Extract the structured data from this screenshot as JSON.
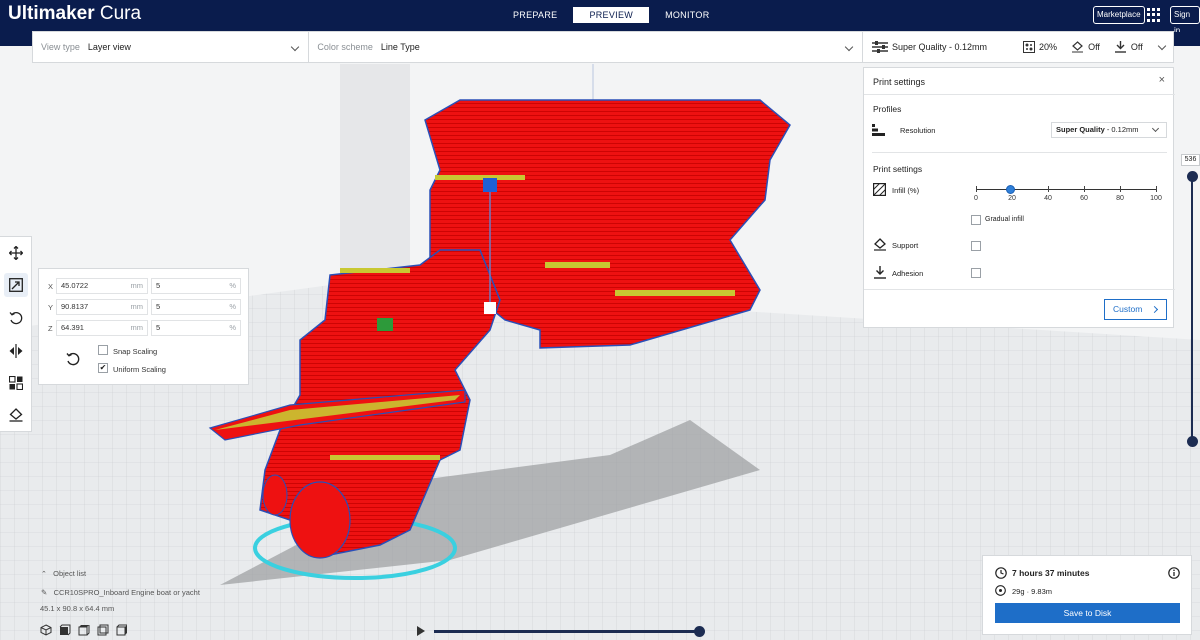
{
  "app": {
    "name_bold": "Ultimaker",
    "name_light": " Cura"
  },
  "stages": [
    "PREPARE",
    "PREVIEW",
    "MONITOR"
  ],
  "header": {
    "marketplace": "Marketplace",
    "signin": "Sign in"
  },
  "viewbar": {
    "view_type_label": "View type",
    "view_type_value": "Layer view",
    "color_scheme_label": "Color scheme",
    "color_scheme_value": "Line Type"
  },
  "quality_bar": {
    "profile": "Super Quality - 0.12mm",
    "infill": "20%",
    "support": "Off",
    "adhesion": "Off"
  },
  "print_settings": {
    "title": "Print settings",
    "close": "×",
    "profiles_heading": "Profiles",
    "resolution_label": "Resolution",
    "resolution_value_bold": "Super Quality",
    "resolution_value_rest": " - 0.12mm",
    "settings_heading": "Print settings",
    "infill_label": "Infill (%)",
    "infill_value": 20,
    "infill_ticks": [
      "0",
      "20",
      "40",
      "60",
      "80",
      "100"
    ],
    "gradual_infill": "Gradual infill",
    "support_label": "Support",
    "adhesion_label": "Adhesion",
    "custom_button": "Custom"
  },
  "scale_panel": {
    "x_label": "X",
    "x_mm": "45.0722",
    "x_pct": "5",
    "y_label": "Y",
    "y_mm": "90.8137",
    "y_pct": "5",
    "z_label": "Z",
    "z_mm": "64.391",
    "z_pct": "5",
    "mm_unit": "mm",
    "pct_unit": "%",
    "snap_scaling": "Snap Scaling",
    "uniform_scaling": "Uniform Scaling",
    "snap_checked": false,
    "uniform_checked": true
  },
  "layer_slider": {
    "current_layer": "536"
  },
  "object_list": {
    "toggle_label": "Object list",
    "job_name": "CCR10SPRO_Inboard Engine boat or yacht",
    "dimensions": "45.1 x 90.8 x 64.4 mm"
  },
  "estimate": {
    "time": "7 hours 37 minutes",
    "material": "29g · 9.83m",
    "save_button": "Save to Disk"
  },
  "colors": {
    "header": "#0a1c4d",
    "accent": "#1e6ec8",
    "model": "#ee1111",
    "infill_lines": "#c8c832"
  }
}
